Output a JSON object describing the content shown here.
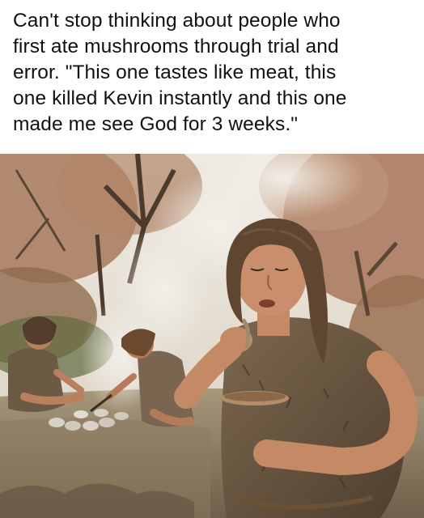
{
  "caption": {
    "lines": [
      "Can't stop thinking about people who",
      "first ate mushrooms through trial and",
      "error. \"This one tastes like meat, this",
      "one killed Kevin instantly and this one",
      "made me see God for 3 weeks.\""
    ]
  },
  "photo": {
    "subject": "prehistoric people by a campfire, one eating mushrooms from a bowl",
    "colors": {
      "sky": "#e9e4da",
      "foliage": "#a5775a",
      "ground": "#9b8a6e",
      "fur": "#6f5a43",
      "skin": "#c98f6c",
      "hair": "#5e4630",
      "smoke": "#ece8e2"
    }
  }
}
